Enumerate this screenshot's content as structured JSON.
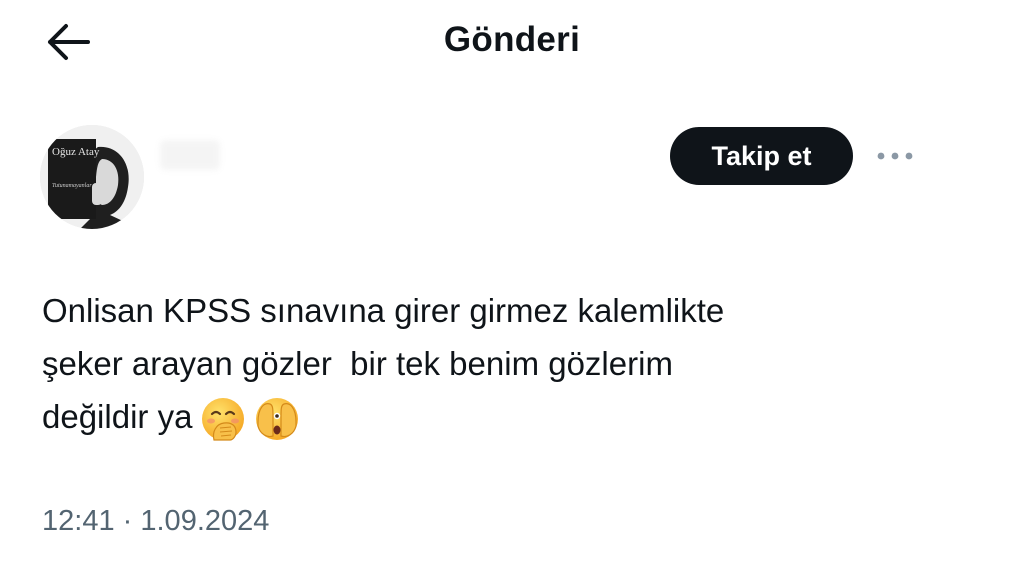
{
  "header": {
    "back_icon": "arrow-left-icon",
    "title": "Gönderi"
  },
  "author": {
    "avatar_book_title": "Oğuz Atay",
    "avatar_book_subtitle": "Tutunamayanlar",
    "follow_label": "Takip et",
    "more_icon": "more-horizontal-icon"
  },
  "tweet": {
    "lines": [
      "Onlisan KPSS sınavına girer girmez kalemlikte",
      "şeker arayan gözler  bir tek benim gözlerim",
      "değildir ya"
    ],
    "emojis": [
      "face-with-hand-over-mouth-emoji",
      "face-with-peeking-eye-emoji"
    ]
  },
  "meta": {
    "time": "12:41",
    "separator": "·",
    "date": "1.09.2024"
  },
  "colors": {
    "text": "#0f1419",
    "muted": "#536471",
    "button_bg": "#0f1419",
    "button_text": "#ffffff"
  }
}
